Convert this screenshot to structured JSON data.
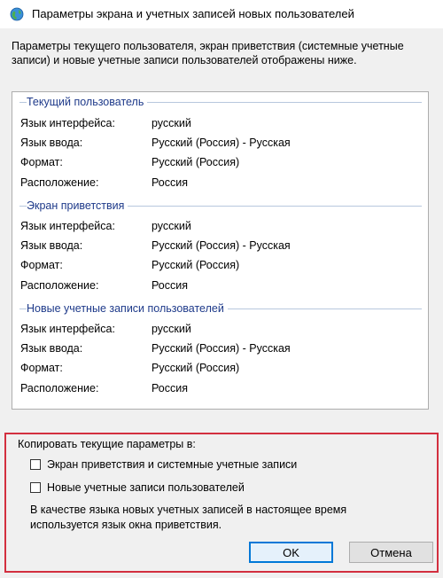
{
  "window": {
    "title": "Параметры экрана и учетных записей новых пользователей",
    "icon": "globe-icon"
  },
  "intro_text": "Параметры текущего пользователя, экран приветствия (системные учетные записи) и новые учетные записи пользователей отображены ниже.",
  "groups": [
    {
      "title": "Текущий пользователь",
      "rows": [
        {
          "key": "Язык интерфейса:",
          "value": "русский"
        },
        {
          "key": "Язык ввода:",
          "value": "Русский (Россия) - Русская"
        },
        {
          "key": "Формат:",
          "value": "Русский (Россия)"
        },
        {
          "key": "Расположение:",
          "value": "Россия"
        }
      ]
    },
    {
      "title": "Экран приветствия",
      "rows": [
        {
          "key": "Язык интерфейса:",
          "value": "русский"
        },
        {
          "key": "Язык ввода:",
          "value": "Русский (Россия) - Русская"
        },
        {
          "key": "Формат:",
          "value": "Русский (Россия)"
        },
        {
          "key": "Расположение:",
          "value": "Россия"
        }
      ]
    },
    {
      "title": "Новые учетные записи пользователей",
      "rows": [
        {
          "key": "Язык интерфейса:",
          "value": "русский"
        },
        {
          "key": "Язык ввода:",
          "value": "Русский (Россия) - Русская"
        },
        {
          "key": "Формат:",
          "value": "Русский (Россия)"
        },
        {
          "key": "Расположение:",
          "value": "Россия"
        }
      ]
    }
  ],
  "copy": {
    "label": "Копировать текущие параметры в:",
    "options": [
      {
        "label": "Экран приветствия и системные учетные записи",
        "checked": false
      },
      {
        "label": "Новые учетные записи пользователей",
        "checked": false
      }
    ],
    "note": "В качестве языка новых учетных записей в настоящее время используется язык окна приветствия."
  },
  "buttons": {
    "ok": "OK",
    "cancel": "Отмена"
  },
  "colors": {
    "highlight_border": "#d32f3f",
    "group_title": "#1e3a8a",
    "ok_border": "#0078d7"
  }
}
